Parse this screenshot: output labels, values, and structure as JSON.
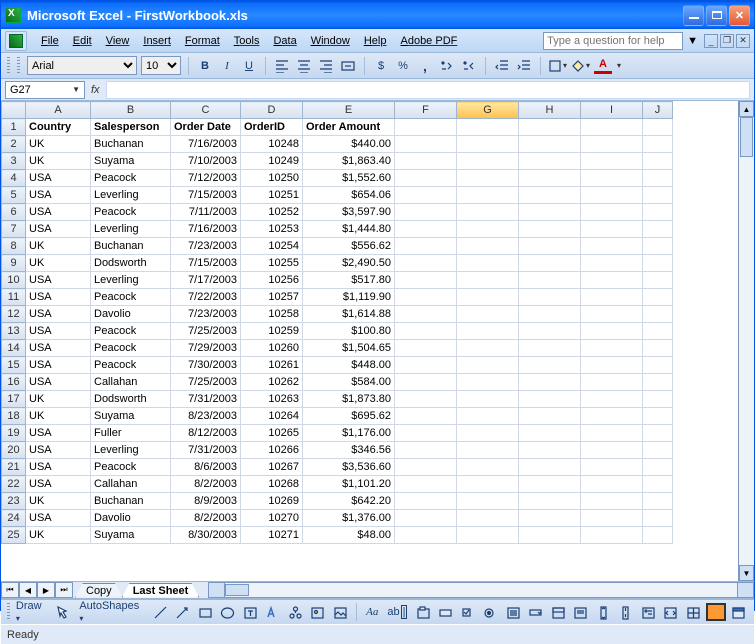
{
  "app": {
    "title": "Microsoft Excel - FirstWorkbook.xls"
  },
  "help_box": {
    "placeholder": "Type a question for help"
  },
  "menu": [
    "File",
    "Edit",
    "View",
    "Insert",
    "Format",
    "Tools",
    "Data",
    "Window",
    "Help",
    "Adobe PDF"
  ],
  "font": {
    "name": "Arial",
    "size": "10"
  },
  "namebox": "G27",
  "fx_label": "fx",
  "columns": [
    "A",
    "B",
    "C",
    "D",
    "E",
    "F",
    "G",
    "H",
    "I",
    "J"
  ],
  "active_column": "G",
  "headers": [
    "Country",
    "Salesperson",
    "Order Date",
    "OrderID",
    "Order Amount"
  ],
  "rows": [
    {
      "n": 1,
      "c": "Country",
      "s": "Salesperson",
      "d": "Order Date",
      "o": "OrderID",
      "a": "Order Amount",
      "hdr": true
    },
    {
      "n": 2,
      "c": "UK",
      "s": "Buchanan",
      "d": "7/16/2003",
      "o": "10248",
      "a": "$440.00"
    },
    {
      "n": 3,
      "c": "UK",
      "s": "Suyama",
      "d": "7/10/2003",
      "o": "10249",
      "a": "$1,863.40"
    },
    {
      "n": 4,
      "c": "USA",
      "s": "Peacock",
      "d": "7/12/2003",
      "o": "10250",
      "a": "$1,552.60"
    },
    {
      "n": 5,
      "c": "USA",
      "s": "Leverling",
      "d": "7/15/2003",
      "o": "10251",
      "a": "$654.06"
    },
    {
      "n": 6,
      "c": "USA",
      "s": "Peacock",
      "d": "7/11/2003",
      "o": "10252",
      "a": "$3,597.90"
    },
    {
      "n": 7,
      "c": "USA",
      "s": "Leverling",
      "d": "7/16/2003",
      "o": "10253",
      "a": "$1,444.80"
    },
    {
      "n": 8,
      "c": "UK",
      "s": "Buchanan",
      "d": "7/23/2003",
      "o": "10254",
      "a": "$556.62"
    },
    {
      "n": 9,
      "c": "UK",
      "s": "Dodsworth",
      "d": "7/15/2003",
      "o": "10255",
      "a": "$2,490.50"
    },
    {
      "n": 10,
      "c": "USA",
      "s": "Leverling",
      "d": "7/17/2003",
      "o": "10256",
      "a": "$517.80"
    },
    {
      "n": 11,
      "c": "USA",
      "s": "Peacock",
      "d": "7/22/2003",
      "o": "10257",
      "a": "$1,119.90"
    },
    {
      "n": 12,
      "c": "USA",
      "s": "Davolio",
      "d": "7/23/2003",
      "o": "10258",
      "a": "$1,614.88"
    },
    {
      "n": 13,
      "c": "USA",
      "s": "Peacock",
      "d": "7/25/2003",
      "o": "10259",
      "a": "$100.80"
    },
    {
      "n": 14,
      "c": "USA",
      "s": "Peacock",
      "d": "7/29/2003",
      "o": "10260",
      "a": "$1,504.65"
    },
    {
      "n": 15,
      "c": "USA",
      "s": "Peacock",
      "d": "7/30/2003",
      "o": "10261",
      "a": "$448.00"
    },
    {
      "n": 16,
      "c": "USA",
      "s": "Callahan",
      "d": "7/25/2003",
      "o": "10262",
      "a": "$584.00"
    },
    {
      "n": 17,
      "c": "UK",
      "s": "Dodsworth",
      "d": "7/31/2003",
      "o": "10263",
      "a": "$1,873.80"
    },
    {
      "n": 18,
      "c": "UK",
      "s": "Suyama",
      "d": "8/23/2003",
      "o": "10264",
      "a": "$695.62"
    },
    {
      "n": 19,
      "c": "USA",
      "s": "Fuller",
      "d": "8/12/2003",
      "o": "10265",
      "a": "$1,176.00"
    },
    {
      "n": 20,
      "c": "USA",
      "s": "Leverling",
      "d": "7/31/2003",
      "o": "10266",
      "a": "$346.56"
    },
    {
      "n": 21,
      "c": "USA",
      "s": "Peacock",
      "d": "8/6/2003",
      "o": "10267",
      "a": "$3,536.60"
    },
    {
      "n": 22,
      "c": "USA",
      "s": "Callahan",
      "d": "8/2/2003",
      "o": "10268",
      "a": "$1,101.20"
    },
    {
      "n": 23,
      "c": "UK",
      "s": "Buchanan",
      "d": "8/9/2003",
      "o": "10269",
      "a": "$642.20"
    },
    {
      "n": 24,
      "c": "USA",
      "s": "Davolio",
      "d": "8/2/2003",
      "o": "10270",
      "a": "$1,376.00"
    },
    {
      "n": 25,
      "c": "UK",
      "s": "Suyama",
      "d": "8/30/2003",
      "o": "10271",
      "a": "$48.00"
    }
  ],
  "sheet_tabs": [
    {
      "label": "Copy",
      "active": false
    },
    {
      "label": "Last Sheet",
      "active": true
    }
  ],
  "draw": {
    "label": "Draw",
    "autoshapes": "AutoShapes"
  },
  "status": "Ready",
  "toolbar_labels": {
    "bold": "B",
    "italic": "I",
    "underline": "U",
    "currency": "$",
    "percent": "%",
    "comma": ",",
    "dec_inc": ".0",
    "font_color": "A"
  }
}
